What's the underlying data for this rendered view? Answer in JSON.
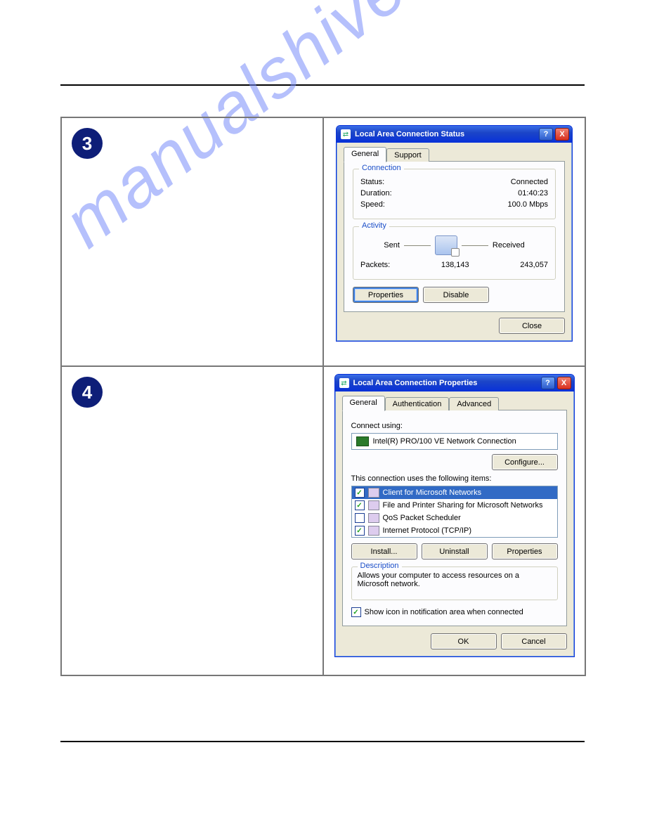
{
  "steps": {
    "s3": "3",
    "s4": "4"
  },
  "watermark": "manualshive.com",
  "status": {
    "title": "Local Area Connection Status",
    "tabs": {
      "general": "General",
      "support": "Support"
    },
    "conn": {
      "legend": "Connection",
      "status_l": "Status:",
      "status_v": "Connected",
      "duration_l": "Duration:",
      "duration_v": "01:40:23",
      "speed_l": "Speed:",
      "speed_v": "100.0 Mbps"
    },
    "act": {
      "legend": "Activity",
      "sent": "Sent",
      "received": "Received",
      "packets_l": "Packets:",
      "sent_v": "138,143",
      "recv_v": "243,057"
    },
    "btn": {
      "properties": "Properties",
      "disable": "Disable",
      "close": "Close"
    }
  },
  "props": {
    "title": "Local Area Connection Properties",
    "tabs": {
      "general": "General",
      "auth": "Authentication",
      "adv": "Advanced"
    },
    "connect_using": "Connect using:",
    "nic": "Intel(R) PRO/100 VE Network Connection",
    "configure": "Configure...",
    "items_label": "This connection uses the following items:",
    "items": [
      {
        "checked": true,
        "label": "Client for Microsoft Networks",
        "selected": true
      },
      {
        "checked": true,
        "label": "File and Printer Sharing for Microsoft Networks",
        "selected": false
      },
      {
        "checked": false,
        "label": "QoS Packet Scheduler",
        "selected": false
      },
      {
        "checked": true,
        "label": "Internet Protocol (TCP/IP)",
        "selected": false
      }
    ],
    "btn": {
      "install": "Install...",
      "uninstall": "Uninstall",
      "properties": "Properties",
      "ok": "OK",
      "cancel": "Cancel"
    },
    "desc": {
      "legend": "Description",
      "text": "Allows your computer to access resources on a Microsoft network."
    },
    "show_icon": "Show icon in notification area when connected"
  },
  "glyph": {
    "help": "?",
    "close": "X",
    "check": "✓"
  }
}
